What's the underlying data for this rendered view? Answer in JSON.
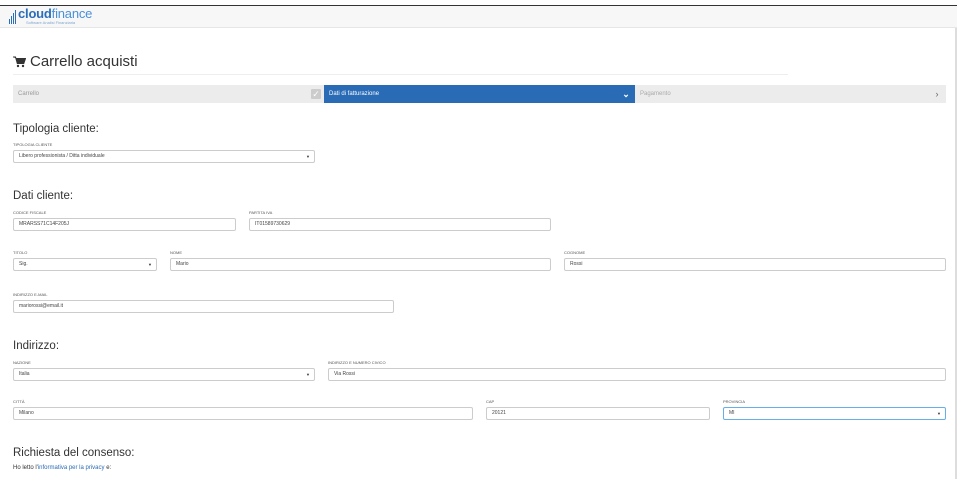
{
  "brand": {
    "name_bold": "cloud",
    "name_light": "finance",
    "tagline": "Software Analisi Finanziaria"
  },
  "page_title": "Carrello acquisti",
  "steps": [
    {
      "label": "Carrello",
      "icon": "check-icon"
    },
    {
      "label": "Dati di fatturazione",
      "icon": "chevron-down-icon"
    },
    {
      "label": "Pagamento",
      "icon": "chevron-right-icon"
    }
  ],
  "tipologia": {
    "heading": "Tipologia cliente:",
    "label": "TIPOLOGIA CLIENTE",
    "value": "Libero professionista / Ditta individuale"
  },
  "dati_cliente": {
    "heading": "Dati cliente:",
    "codice_fiscale_label": "CODICE FISCALE",
    "codice_fiscale_value": "MRARSS71C14F205J",
    "partita_iva_label": "PARTITA IVA",
    "partita_iva_value": "IT01589730629",
    "titolo_label": "TITOLO",
    "titolo_value": "Sig.",
    "nome_label": "NOME",
    "nome_value": "Mario",
    "cognome_label": "COGNOME",
    "cognome_value": "Rossi",
    "email_label": "INDIRIZZO E-MAIL",
    "email_value": "mariorossi@email.it"
  },
  "indirizzo": {
    "heading": "Indirizzo:",
    "nazione_label": "NAZIONE",
    "nazione_value": "Italia",
    "via_label": "INDIRIZZO E NUMERO CIVICO",
    "via_value": "Via Rossi",
    "citta_label": "CITTÀ",
    "citta_value": "Milano",
    "cap_label": "CAP",
    "cap_value": "20121",
    "provincia_label": "PROVINCIA",
    "provincia_value": "MI"
  },
  "consenso": {
    "heading": "Richiesta del consenso:",
    "text_before": "Ho letto l'",
    "link": "informativa per la privacy",
    "text_after": " e:"
  },
  "colors": {
    "brand_blue": "#2a6bb5",
    "step_grey": "#ececec"
  }
}
